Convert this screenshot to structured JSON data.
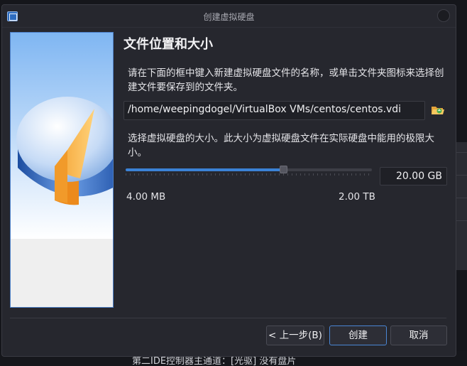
{
  "window": {
    "title": "创建虚拟硬盘"
  },
  "page": {
    "heading": "文件位置和大小",
    "description_location": "请在下面的框中键入新建虚拟硬盘文件的名称，或单击文件夹图标来选择创建文件要保存到的文件夹。",
    "file_path": "/home/weepingdogel/VirtualBox VMs/centos/centos.vdi",
    "description_size": "选择虚拟硬盘的大小。此大小为虚拟硬盘文件在实际硬盘中能用的极限大小。",
    "size_value": "20.00 GB",
    "slider_level_fraction": 0.64,
    "min_label": "4.00 MB",
    "max_label": "2.00 TB"
  },
  "buttons": {
    "back": "< 上一步(B)",
    "create": "创建",
    "cancel": "取消"
  },
  "background": {
    "bottom_text": "第二IDE控制器主通道：[光驱] 没有盘片"
  },
  "icons": {
    "app": "virtualbox-icon",
    "folder": "folder-open-icon",
    "close": "close-circle-icon"
  },
  "colors": {
    "accent": "#3b82d6",
    "dialog_bg": "#26272e",
    "field_bg": "#1f2026"
  }
}
